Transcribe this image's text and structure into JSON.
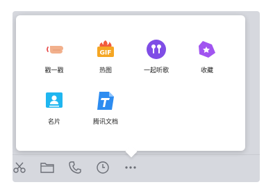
{
  "popup": {
    "items": [
      {
        "label": "戳一戳",
        "icon": "poke-hand-icon"
      },
      {
        "label": "热图",
        "icon": "gif-fire-icon"
      },
      {
        "label": "一起听歌",
        "icon": "earphones-icon"
      },
      {
        "label": "收藏",
        "icon": "favorite-tag-icon"
      },
      {
        "label": "名片",
        "icon": "contact-card-icon"
      },
      {
        "label": "腾讯文档",
        "icon": "tencent-docs-icon"
      }
    ],
    "gif_text": "GIF"
  },
  "toolbar": {
    "icons": [
      "scissors-icon",
      "folder-icon",
      "phone-icon",
      "clock-icon",
      "more-icon"
    ]
  },
  "colors": {
    "backdrop": "#d6d8de",
    "toolbar_icon": "#6b6e76",
    "fire_orange": "#f5a623",
    "purple": "#7f4de6",
    "card_blue": "#1fb6f0",
    "docs_blue": "#2d8cf0",
    "hand": "#f2b08c"
  }
}
